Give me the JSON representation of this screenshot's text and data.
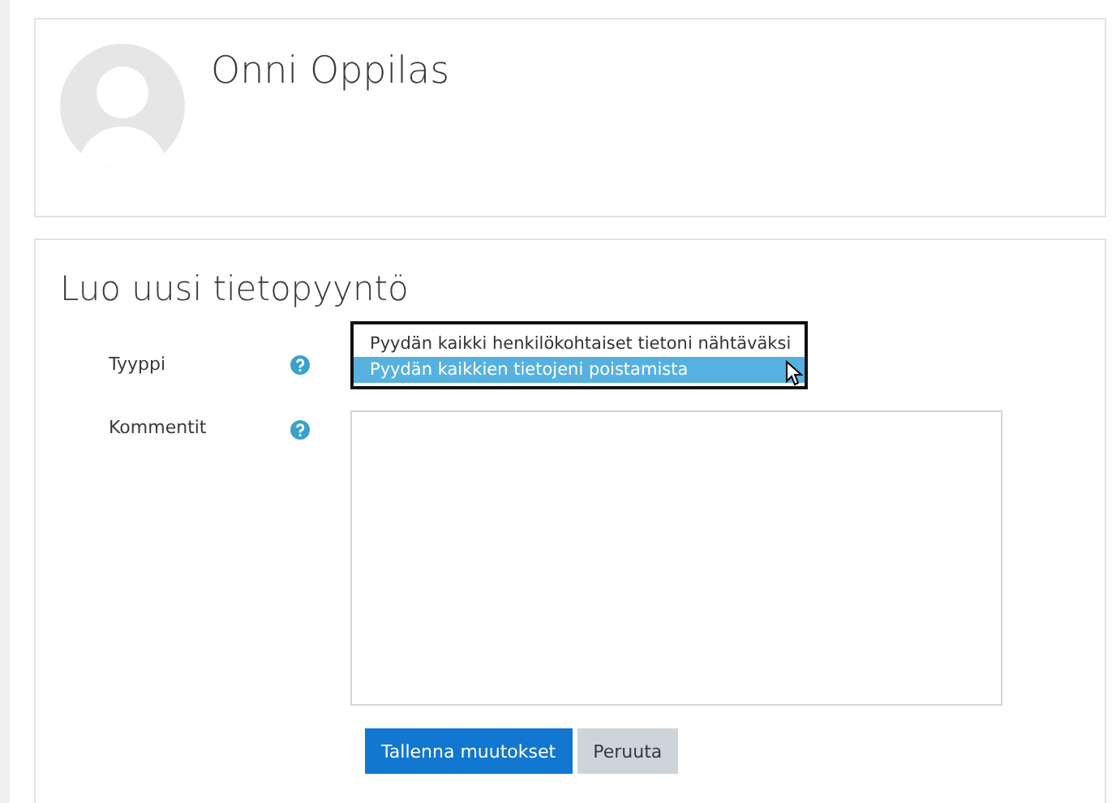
{
  "profile": {
    "name": "Onni Oppilas"
  },
  "form": {
    "title": "Luo uusi tietopyyntö",
    "type_field": {
      "label": "Tyyppi",
      "options": [
        {
          "label": "Pyydän kaikki henkilökohtaiset tietoni nähtäväksi",
          "selected": false
        },
        {
          "label": "Pyydän kaikkien tietojeni poistamista",
          "selected": true
        }
      ]
    },
    "comments_field": {
      "label": "Kommentit"
    },
    "buttons": [
      {
        "label": "Tallenna muutokset",
        "kind": "primary"
      },
      {
        "label": "Peruuta",
        "kind": "secondary"
      }
    ]
  }
}
